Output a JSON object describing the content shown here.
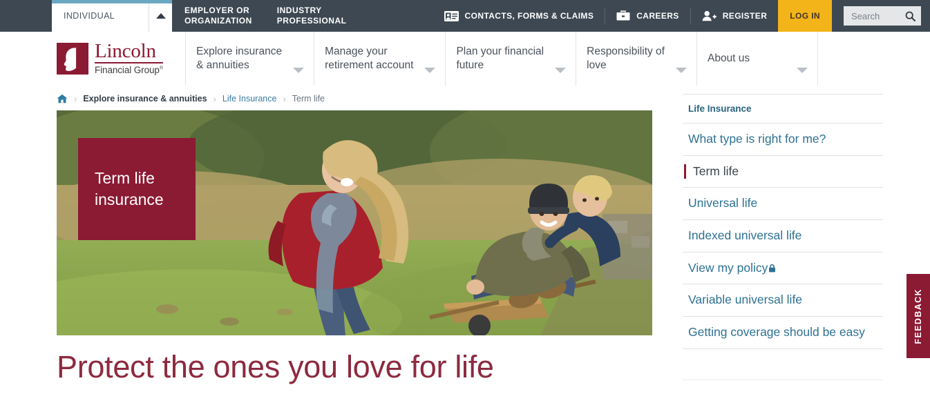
{
  "colors": {
    "header_bg": "#3d4852",
    "brand_red": "#8b1a33",
    "accent_blue": "#6ba8c1",
    "login_gold": "#f2b418",
    "link_blue": "#2e7193",
    "title_maroon": "#8d2a3f"
  },
  "utility_bar": {
    "audience_tabs": [
      {
        "label": "INDIVIDUAL",
        "active": true,
        "icon": "caret-up-icon"
      },
      {
        "label": "EMPLOYER OR\nORGANIZATION",
        "active": false
      },
      {
        "label": "INDUSTRY\nPROFESSIONAL",
        "active": false
      }
    ],
    "links": [
      {
        "label": "CONTACTS, FORMS & CLAIMS",
        "icon": "contact-card-icon"
      },
      {
        "label": "CAREERS",
        "icon": "briefcase-icon"
      },
      {
        "label": "REGISTER",
        "icon": "person-add-icon"
      }
    ],
    "login_label": "LOG IN",
    "search": {
      "placeholder": "Search",
      "value": "",
      "icon": "search-icon"
    }
  },
  "logo": {
    "name": "Lincoln",
    "tagline": "Financial Group",
    "registered_mark": "®",
    "mark_icon": "lincoln-silhouette-icon"
  },
  "main_nav": {
    "items": [
      {
        "label": "Explore insurance\n& annuities",
        "has_dropdown": true
      },
      {
        "label": "Manage your\nretirement account",
        "has_dropdown": true
      },
      {
        "label": "Plan your financial\nfuture",
        "has_dropdown": true
      },
      {
        "label": "Responsibility of\nlove",
        "has_dropdown": true
      },
      {
        "label": "About us",
        "has_dropdown": true
      }
    ]
  },
  "breadcrumb": {
    "home_icon": "home-icon",
    "separator": "›",
    "items": [
      {
        "label": "Explore insurance & annuities",
        "style": "strong"
      },
      {
        "label": "Life Insurance",
        "style": "link"
      },
      {
        "label": "Term life",
        "style": "current"
      }
    ]
  },
  "hero": {
    "badge_text": "Term life insurance",
    "image_alt": "Father and two children playing with a wheelbarrow on an autumn lawn"
  },
  "main": {
    "page_title": "Protect the ones you love for life"
  },
  "sidebar": {
    "heading": "Life Insurance",
    "items": [
      {
        "label": "What type is right for me?",
        "active": false,
        "locked": false
      },
      {
        "label": "Term life",
        "active": true,
        "locked": false
      },
      {
        "label": "Universal life",
        "active": false,
        "locked": false
      },
      {
        "label": "Indexed universal life",
        "active": false,
        "locked": false
      },
      {
        "label": "View my policy",
        "active": false,
        "locked": true,
        "lock_icon": "lock-icon"
      },
      {
        "label": "Variable universal life",
        "active": false,
        "locked": false
      },
      {
        "label": "Getting coverage should be easy",
        "active": false,
        "locked": false
      }
    ]
  },
  "feedback_tab": {
    "label": "FEEDBACK"
  }
}
